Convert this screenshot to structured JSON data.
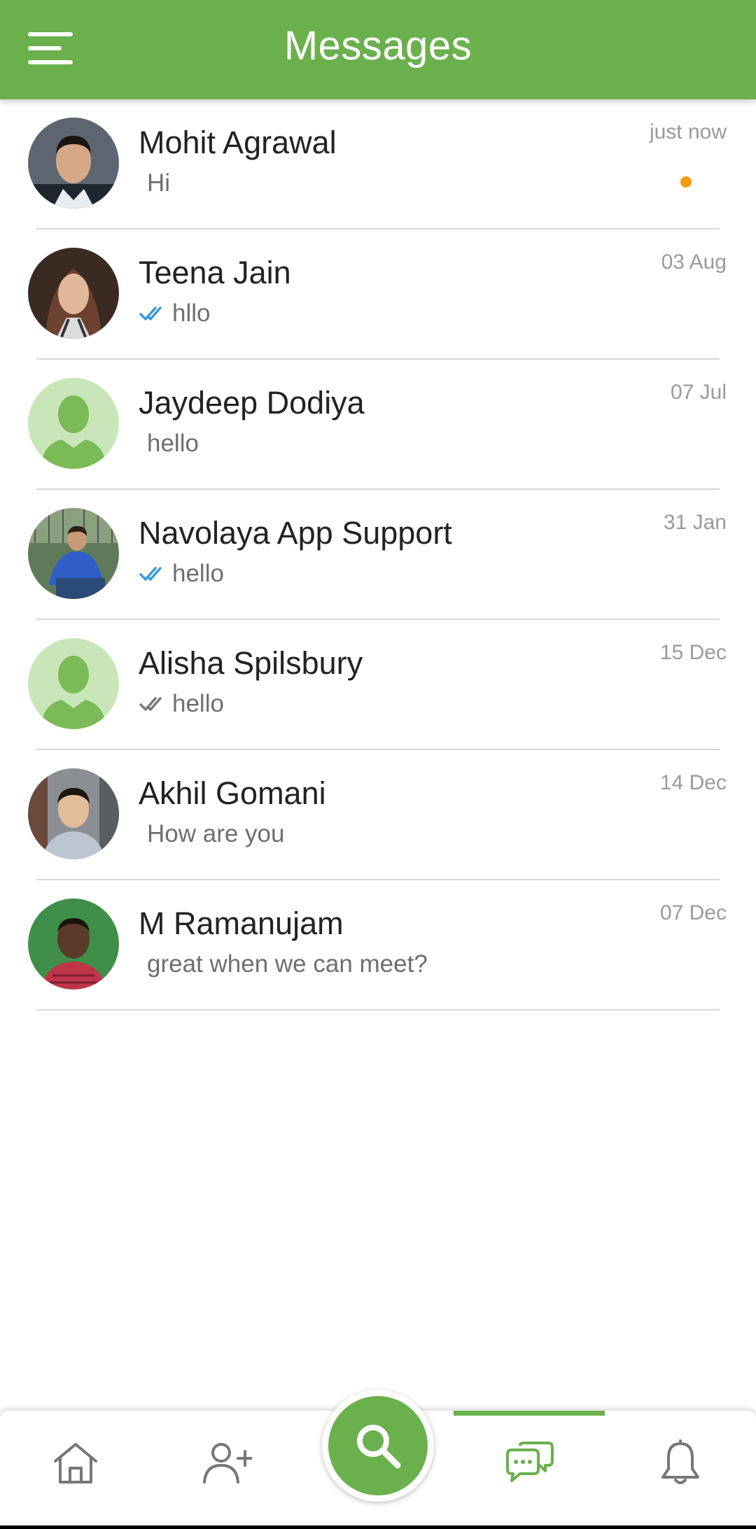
{
  "header": {
    "title": "Messages",
    "menu_icon": "menu-icon",
    "background": "#6ab04c"
  },
  "conversations": [
    {
      "name": "Mohit Agrawal",
      "preview": "Hi",
      "time": "just now",
      "status": "unread",
      "avatar": "photo"
    },
    {
      "name": "Teena Jain",
      "preview": "hllo",
      "time": "03 Aug",
      "status": "read",
      "avatar": "photo"
    },
    {
      "name": "Jaydeep Dodiya",
      "preview": "hello",
      "time": "07 Jul",
      "status": "none",
      "avatar": "placeholder"
    },
    {
      "name": "Navolaya App Support",
      "preview": "hello",
      "time": "31 Jan",
      "status": "read",
      "avatar": "photo"
    },
    {
      "name": "Alisha Spilsbury",
      "preview": "hello",
      "time": "15 Dec",
      "status": "delivered",
      "avatar": "placeholder"
    },
    {
      "name": "Akhil Gomani",
      "preview": "How are you",
      "time": "14 Dec",
      "status": "none",
      "avatar": "photo"
    },
    {
      "name": "M Ramanujam",
      "preview": "great when we can meet?",
      "time": "07 Dec",
      "status": "none",
      "avatar": "photo"
    }
  ],
  "bottom_nav": {
    "items": [
      {
        "icon": "home-icon",
        "active": false
      },
      {
        "icon": "add-user-icon",
        "active": false
      },
      {
        "icon": "search-icon",
        "active": false
      },
      {
        "icon": "chat-icon",
        "active": true
      },
      {
        "icon": "bell-icon",
        "active": false
      }
    ]
  },
  "colors": {
    "accent": "#6ab04c",
    "unread_dot": "#f39c12",
    "read_tick": "#3a9ad9",
    "delivered_tick": "#777777",
    "placeholder_avatar_bg": "#c8e6b8"
  }
}
